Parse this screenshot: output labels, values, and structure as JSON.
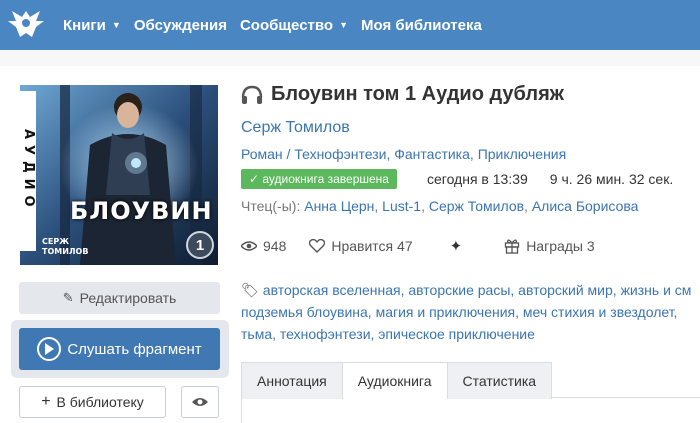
{
  "header": {
    "nav": [
      {
        "label": "Книги",
        "dropdown": true
      },
      {
        "label": "Обсуждения",
        "dropdown": false
      },
      {
        "label": "Сообщество",
        "dropdown": true
      },
      {
        "label": "Моя библиотека",
        "dropdown": false
      }
    ],
    "logo_icon": "eagle-logo-icon"
  },
  "cover": {
    "vertical_text": "АУДИО",
    "title": "БЛОУВИН",
    "author": "СЕРЖ ТОМИЛОВ",
    "badge": "1"
  },
  "sidebar": {
    "edit_label": "Редактировать",
    "listen_label": "Слушать фрагмент",
    "library_label": "В библиотеку"
  },
  "book": {
    "title": "Блоувин том 1 Аудио дубляж",
    "author": "Серж Томилов",
    "genres": [
      "Роман",
      "Технофэнтези",
      "Фантастика",
      "Приключения"
    ],
    "status": "аудиокнига завершена",
    "updated": "сегодня в 13:39",
    "duration": "9 ч. 26 мин. 32 сек.",
    "readers_label": "Чтец(-ы):",
    "readers": [
      "Анна Церн",
      "Lust-1",
      "Серж Томилов",
      "Алиса Борисова"
    ],
    "views": "948",
    "likes_label": "Нравится",
    "likes": "47",
    "awards_label": "Награды",
    "awards": "3",
    "tags": [
      "авторская вселенная, авторские расы, авторский мир, жизнь и см",
      "подземья блоувина, магия и приключения, меч стихия и звездолет,",
      "тьма, технофэнтези, эпическое приключение"
    ]
  },
  "tabs": [
    {
      "label": "Аннотация",
      "active": false
    },
    {
      "label": "Аудиокнига",
      "active": true
    },
    {
      "label": "Статистика",
      "active": false
    }
  ],
  "colors": {
    "header": "#4a86c2",
    "link": "#3b75b0",
    "primary_button": "#3f78b3",
    "status_badge": "#5cb85c"
  }
}
